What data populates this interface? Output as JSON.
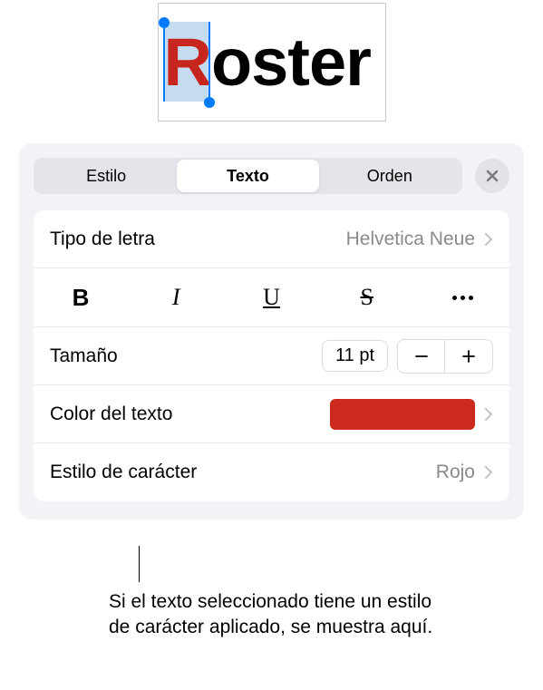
{
  "preview": {
    "text": "Roster",
    "first_letter": "R",
    "rest": "oster"
  },
  "tabs": {
    "style": "Estilo",
    "text": "Texto",
    "order": "Orden"
  },
  "font_row": {
    "label": "Tipo de letra",
    "value": "Helvetica Neue"
  },
  "format_icons": {
    "bold": "B",
    "italic": "I",
    "underline": "U",
    "strike": "S"
  },
  "size_row": {
    "label": "Tamaño",
    "value": "11 pt"
  },
  "color_row": {
    "label": "Color del texto",
    "color": "#cb2a1d"
  },
  "char_style_row": {
    "label": "Estilo de carácter",
    "value": "Rojo"
  },
  "callout": "Si el texto seleccionado tiene un estilo de carácter aplicado, se muestra aquí."
}
